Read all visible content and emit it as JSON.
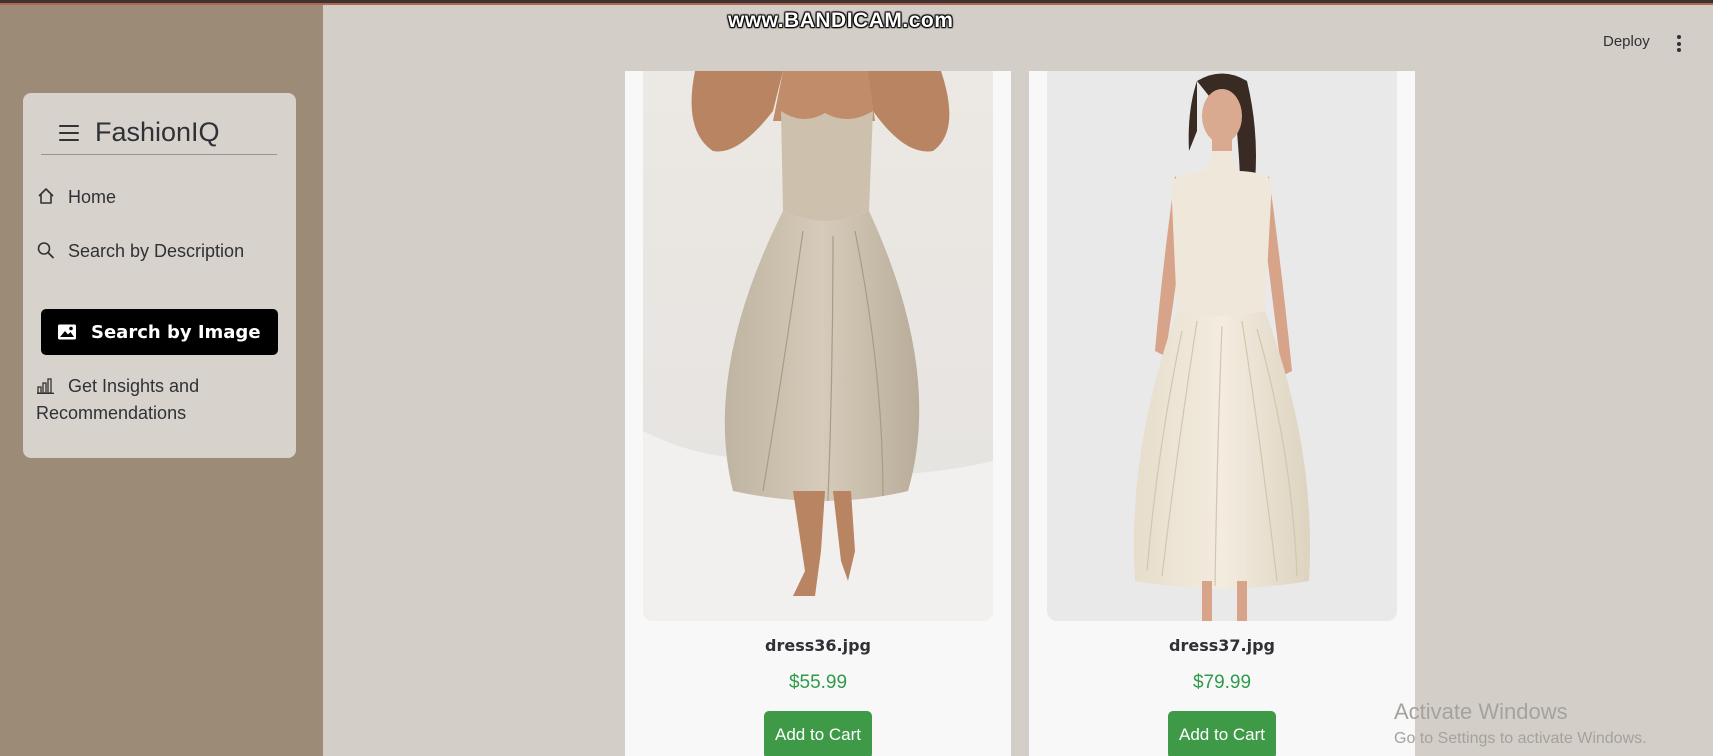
{
  "watermark": "www.BANDICAM.com",
  "sidebar": {
    "brand": "FashionIQ",
    "items": [
      {
        "label": "Home",
        "icon": "home-icon"
      },
      {
        "label": "Search by Description",
        "icon": "search-icon"
      },
      {
        "label": "Search by Image",
        "icon": "image-icon",
        "active": true
      },
      {
        "label": "Get Insights and Recommendations",
        "icon": "bar-chart-icon"
      }
    ]
  },
  "header": {
    "deploy_label": "Deploy",
    "menu_icon": "kebab-menu-icon"
  },
  "products": [
    {
      "name": "dress36.jpg",
      "price": "$55.99",
      "button": "Add to Cart"
    },
    {
      "name": "dress37.jpg",
      "price": "$79.99",
      "button": "Add to Cart"
    }
  ],
  "os_overlay": {
    "title": "Activate Windows",
    "subtitle": "Go to Settings to activate Windows."
  },
  "colors": {
    "sidebar_bg": "#9c8c77",
    "main_bg": "#d3cec7",
    "active_nav_bg": "#000000",
    "price_green": "#2e9c4a",
    "cart_button": "#3f9a48"
  }
}
